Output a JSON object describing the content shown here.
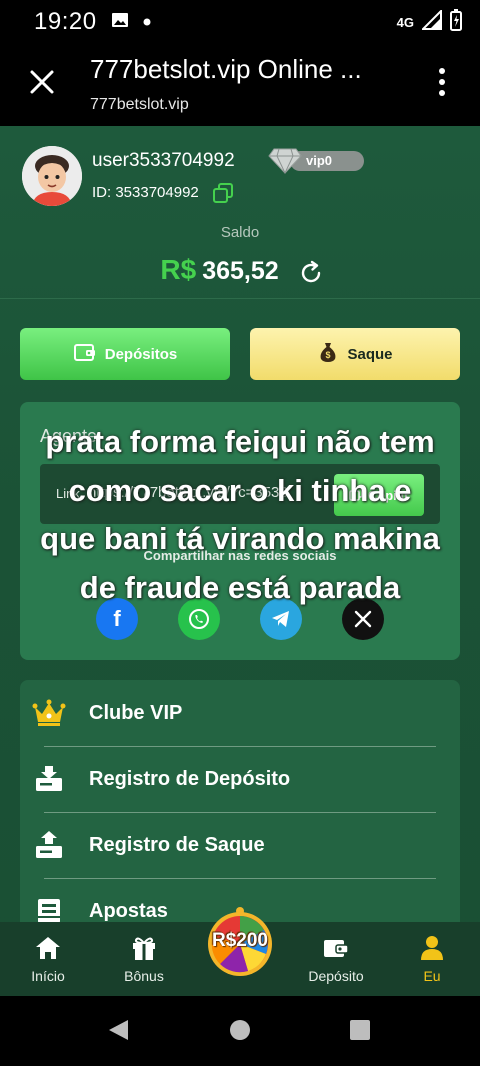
{
  "status": {
    "time": "19:20",
    "network": "4G"
  },
  "browser": {
    "title": "777betslot.vip Online ...",
    "url": "777betslot.vip"
  },
  "profile": {
    "username": "user3533704992",
    "vip_level": "vip0",
    "user_id": "ID: 3533704992",
    "saldo_label": "Saldo",
    "currency": "R$",
    "balance": "365,52"
  },
  "actions": {
    "deposit_label": "Depósitos",
    "withdraw_label": "Saque"
  },
  "agent": {
    "title": "Agente",
    "link_label": "Link",
    "link_url": "https://777betslot.vip/?c=3533",
    "copy_label": "Copiar",
    "share_label": "Compartilhar nas redes sociais",
    "socials": [
      "facebook-icon",
      "whatsapp-icon",
      "telegram-icon",
      "x-icon"
    ]
  },
  "overlay_caption": "prata forma feiqui não tem como sacar o ki tinha e que bani tá virando makina de fraude está parada",
  "menu": {
    "items": [
      {
        "label": "Clube VIP",
        "icon": "crown-icon"
      },
      {
        "label": "Registro de Depósito",
        "icon": "deposit-record-icon"
      },
      {
        "label": "Registro de Saque",
        "icon": "withdraw-record-icon"
      },
      {
        "label": "Apostas",
        "icon": "bets-icon"
      }
    ]
  },
  "bottom_nav": {
    "items": [
      {
        "label": "Início",
        "icon": "home-icon"
      },
      {
        "label": "Bônus",
        "icon": "gift-icon"
      },
      {
        "label": "Depósito",
        "icon": "wallet-icon"
      },
      {
        "label": "Eu",
        "icon": "user-icon"
      }
    ],
    "wheel_amount": "R$200",
    "active": "Eu"
  },
  "colors": {
    "page_bg": "#1e5a3c",
    "accent_green": "#45d14e",
    "withdraw_yellow": "#f2dc6b",
    "active_nav": "#f2c318"
  }
}
